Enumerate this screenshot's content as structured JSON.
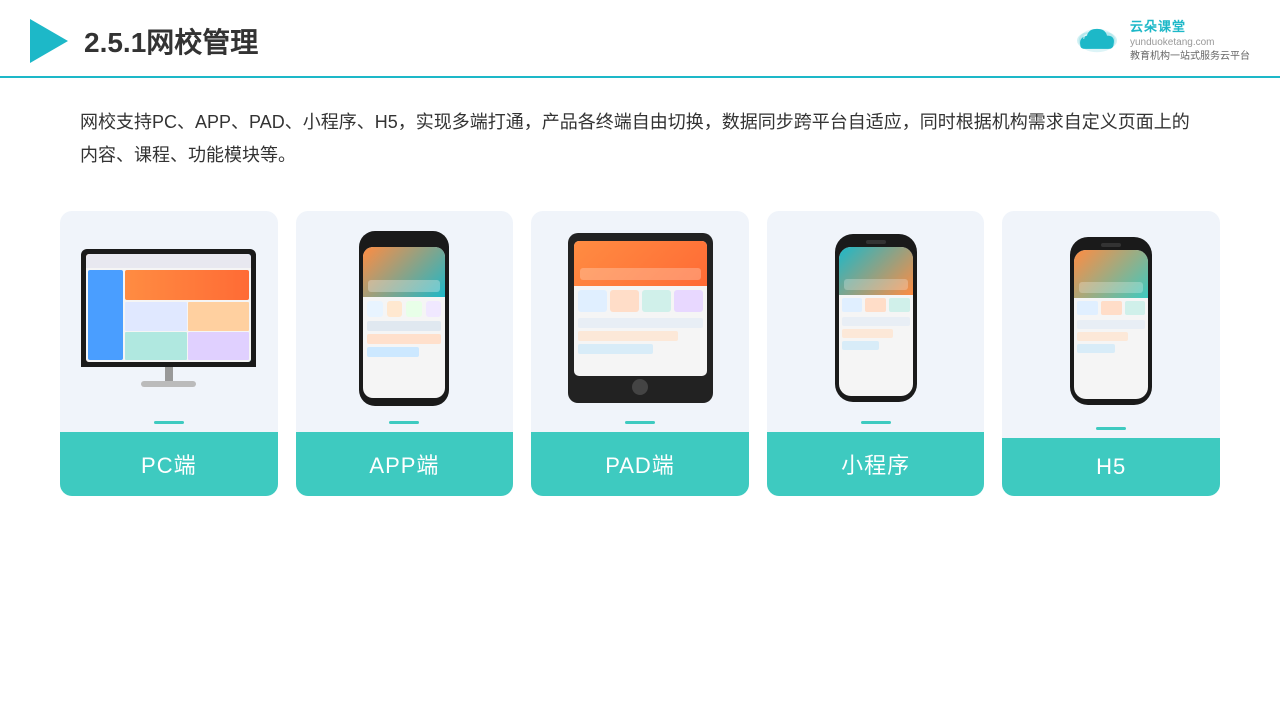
{
  "header": {
    "title": "2.5.1网校管理",
    "logo_name": "云朵课堂",
    "logo_url": "yunduoketang.com",
    "logo_tagline": "教育机构一站\n式服务云平台"
  },
  "description": {
    "text": "网校支持PC、APP、PAD、小程序、H5，实现多端打通，产品各终端自由切换，数据同步跨平台自适应，同时根据机构需求自定义页面上的内容、课程、功能模块等。"
  },
  "cards": [
    {
      "id": "pc",
      "label": "PC端"
    },
    {
      "id": "app",
      "label": "APP端"
    },
    {
      "id": "pad",
      "label": "PAD端"
    },
    {
      "id": "miniprogram",
      "label": "小程序"
    },
    {
      "id": "h5",
      "label": "H5"
    }
  ],
  "colors": {
    "primary": "#3ecac0",
    "accent": "#1db8c8",
    "border": "#1db8c8",
    "card_bg": "#f0f4fa",
    "label_bg": "#3ecac0"
  }
}
